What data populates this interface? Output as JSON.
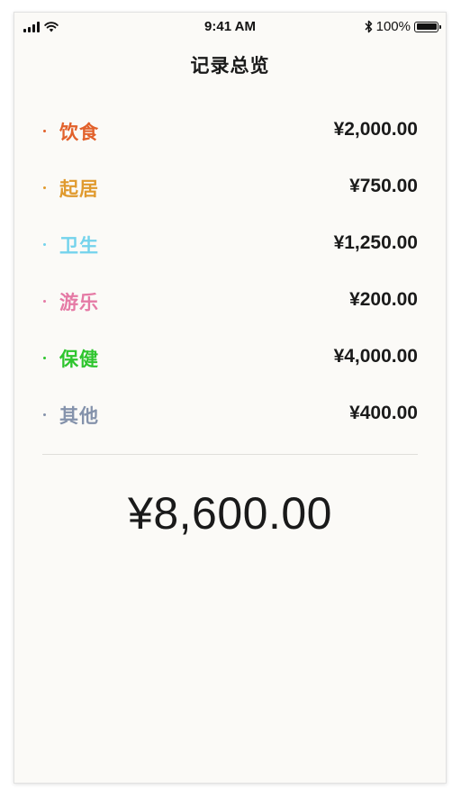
{
  "status_bar": {
    "time": "9:41 AM",
    "battery": "100%",
    "icons": [
      "signal-icon",
      "wifi-icon",
      "bluetooth-icon",
      "battery-icon"
    ]
  },
  "page": {
    "title": "记录总览"
  },
  "records": [
    {
      "label": "饮食",
      "amount": "¥2,000.00",
      "color": "#e2612b"
    },
    {
      "label": "起居",
      "amount": "¥750.00",
      "color": "#e09a2e"
    },
    {
      "label": "卫生",
      "amount": "¥1,250.00",
      "color": "#74d3ec"
    },
    {
      "label": "游乐",
      "amount": "¥200.00",
      "color": "#e57aa5"
    },
    {
      "label": "保健",
      "amount": "¥4,000.00",
      "color": "#2ec52e"
    },
    {
      "label": "其他",
      "amount": "¥400.00",
      "color": "#8492ab"
    }
  ],
  "total": {
    "amount": "¥8,600.00"
  }
}
